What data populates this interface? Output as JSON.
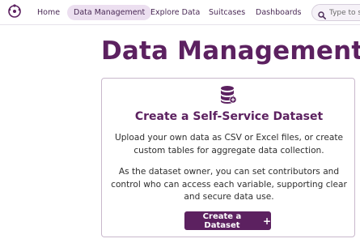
{
  "nav": {
    "items": [
      {
        "label": "Home"
      },
      {
        "label": "Data Management"
      },
      {
        "label": "Explore Data"
      },
      {
        "label": "Suitcases"
      },
      {
        "label": "Dashboards"
      }
    ],
    "active_item": "Data Management",
    "search_placeholder": "Type to search"
  },
  "page": {
    "title": "Data Management"
  },
  "card": {
    "icon": "database-add-icon",
    "title": "Create a Self-Service Dataset",
    "paragraph_1": "Upload your own data as CSV or Excel files, or create custom tables for aggregate data collection.",
    "paragraph_2": "As the dataset owner, you can set contributors and control who can access each variable, supporting clear and secure data use.",
    "button_label": "Create a Dataset",
    "button_icon": "+"
  },
  "colors": {
    "brand": "#5c2160",
    "active_tab_bg": "#ecdff0"
  }
}
